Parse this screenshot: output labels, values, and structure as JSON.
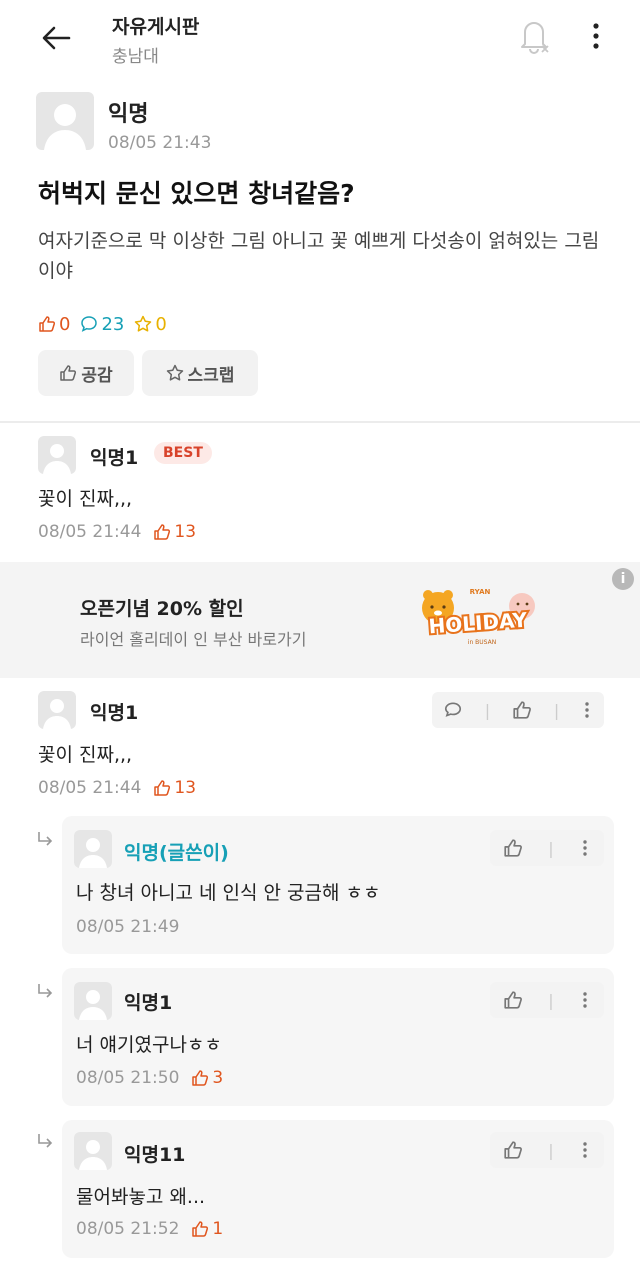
{
  "header": {
    "title": "자유게시판",
    "subtitle": "충남대"
  },
  "post": {
    "author": "익명",
    "date": "08/05 21:43",
    "title": "허벅지 문신 있으면 창녀같음?",
    "body": "여자기준으로 막 이상한 그림 아니고 꽃 예쁘게 다섯송이 얽혀있는 그림이야",
    "likes": "0",
    "comments": "23",
    "scraps": "0",
    "like_button": "공감",
    "scrap_button": "스크랩"
  },
  "best_comment": {
    "author": "익명1",
    "badge": "BEST",
    "text": "꽃이 진짜,,,",
    "date": "08/05 21:44",
    "likes": "13"
  },
  "ad": {
    "title": "오픈기념 20% 할인",
    "subtitle": "라이언 홀리데이 인 부산 바로가기",
    "logo_text": "HOLIDAY",
    "logo_top": "RYAN",
    "logo_bottom": "in BUSAN",
    "info_icon": "i"
  },
  "comments": [
    {
      "author": "익명1",
      "text": "꽃이 진짜,,,",
      "date": "08/05 21:44",
      "likes": "13"
    }
  ],
  "replies": [
    {
      "author": "익명(글쓴이)",
      "text": "나 창녀 아니고 네 인식 안 궁금해 ㅎㅎ",
      "date": "08/05 21:49",
      "likes": ""
    },
    {
      "author": "익명1",
      "text": "너 얘기였구나ㅎㅎ",
      "date": "08/05 21:50",
      "likes": "3"
    },
    {
      "author": "익명11",
      "text": "물어봐놓고 왜...",
      "date": "08/05 21:52",
      "likes": "1"
    }
  ],
  "colors": {
    "like": "#e0561f",
    "comment": "#17a0b6",
    "scrap": "#e8b100",
    "writer": "#17a0b6",
    "best": "#d8432b"
  },
  "icons": [
    "back-arrow-icon",
    "bell-off-icon",
    "kebab-icon",
    "thumb-up-icon",
    "comment-icon",
    "star-icon",
    "reply-arrow-icon",
    "info-icon"
  ]
}
